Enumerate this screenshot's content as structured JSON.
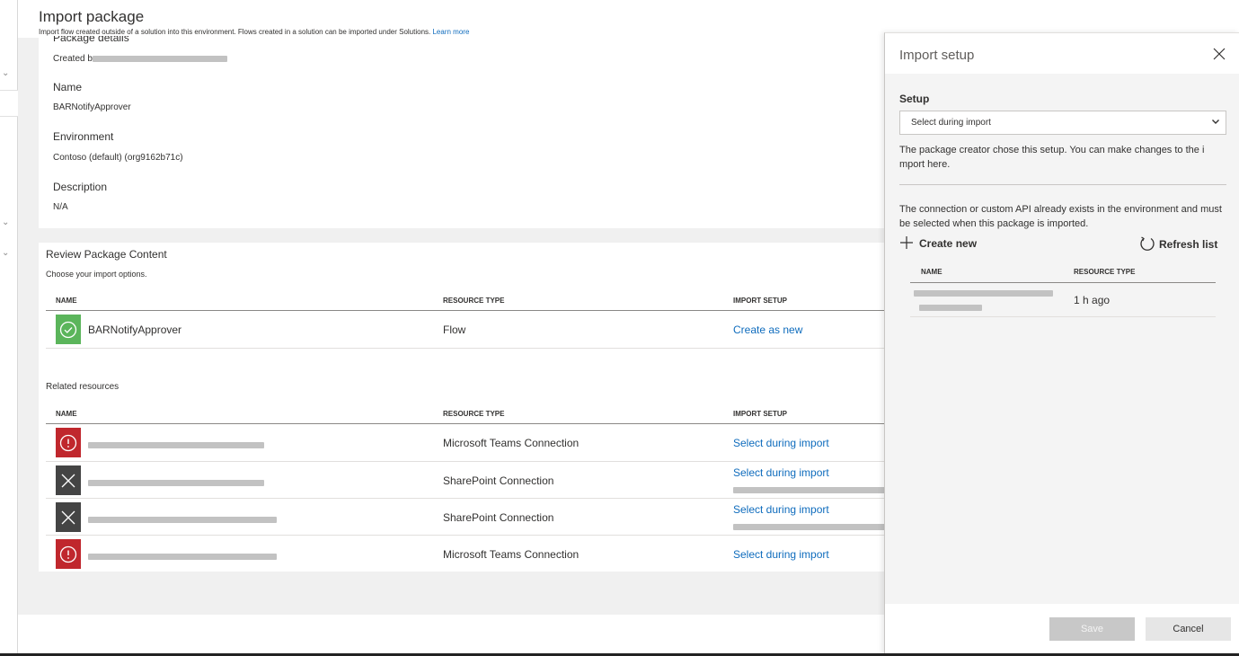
{
  "page": {
    "title": "Import package",
    "subtitle": "Import flow created outside of a solution into this environment. Flows created in a solution can be imported under Solutions.",
    "learn_more": "Learn more"
  },
  "details": {
    "header": "Package details",
    "created_prefix": "Created b",
    "name_label": "Name",
    "name_value": "BARNotifyApprover",
    "environment_label": "Environment",
    "environment_value": "Contoso (default) (org9162b71c)",
    "description_label": "Description",
    "description_value": "N/A"
  },
  "review": {
    "title": "Review Package Content",
    "subtitle": "Choose your import options.",
    "columns": {
      "name": "NAME",
      "resource_type": "RESOURCE TYPE",
      "import_setup": "IMPORT SETUP"
    },
    "flow_row": {
      "name": "BARNotifyApprover",
      "type": "Flow",
      "setup": "Create as new"
    },
    "related_title": "Related resources",
    "related_rows": [
      {
        "status": "error",
        "type": "Microsoft Teams Connection",
        "setup": "Select during import"
      },
      {
        "status": "removed",
        "type": "SharePoint Connection",
        "setup": "Select during import"
      },
      {
        "status": "removed",
        "type": "SharePoint Connection",
        "setup": "Select during import"
      },
      {
        "status": "error",
        "type": "Microsoft Teams Connection",
        "setup": "Select during import"
      }
    ]
  },
  "panel": {
    "title": "Import setup",
    "setup_label": "Setup",
    "setup_selected": "Select during import",
    "setup_help": "The package creator chose this setup. You can make changes to the i mport here.",
    "connection_help": "The connection or custom API already exists in the environment and must be selected when this package is imported.",
    "create_new": "Create new",
    "refresh_list": "Refresh list",
    "columns": {
      "name": "NAME",
      "resource_type": "RESOURCE TYPE"
    },
    "rows": [
      {
        "time": "1 h ago"
      }
    ],
    "save": "Save",
    "cancel": "Cancel"
  },
  "icons": {
    "success": "check-circle-icon",
    "error": "error-circle-icon",
    "removed": "x-icon",
    "close": "close-icon",
    "chevron": "chevron-down-icon",
    "add": "plus-icon",
    "refresh": "refresh-icon"
  },
  "colors": {
    "link": "#0f6cbd",
    "success": "#5bb55b",
    "error": "#c0272d",
    "removed": "#444444"
  }
}
